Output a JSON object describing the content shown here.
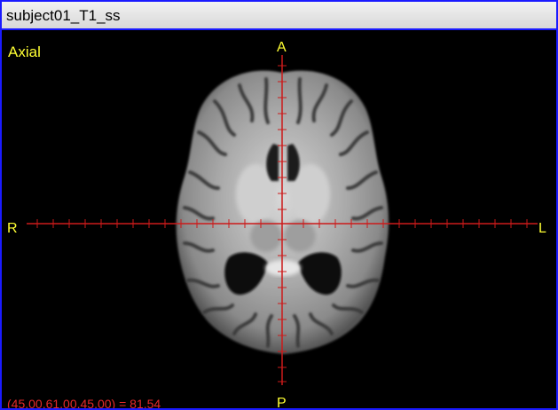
{
  "window": {
    "title": "subject01_T1_ss",
    "border_color": "#1a1aff"
  },
  "viewer": {
    "view_label": "Axial",
    "orientation": {
      "anterior": "A",
      "posterior": "P",
      "right": "R",
      "left": "L"
    },
    "readout": "(45.00,61.00,45.00) = 81.54",
    "crosshair_color": "#cc1a1a",
    "label_color": "#ffff33",
    "image_kind": "axial brain MRI slice (T1, skull-stripped)"
  }
}
